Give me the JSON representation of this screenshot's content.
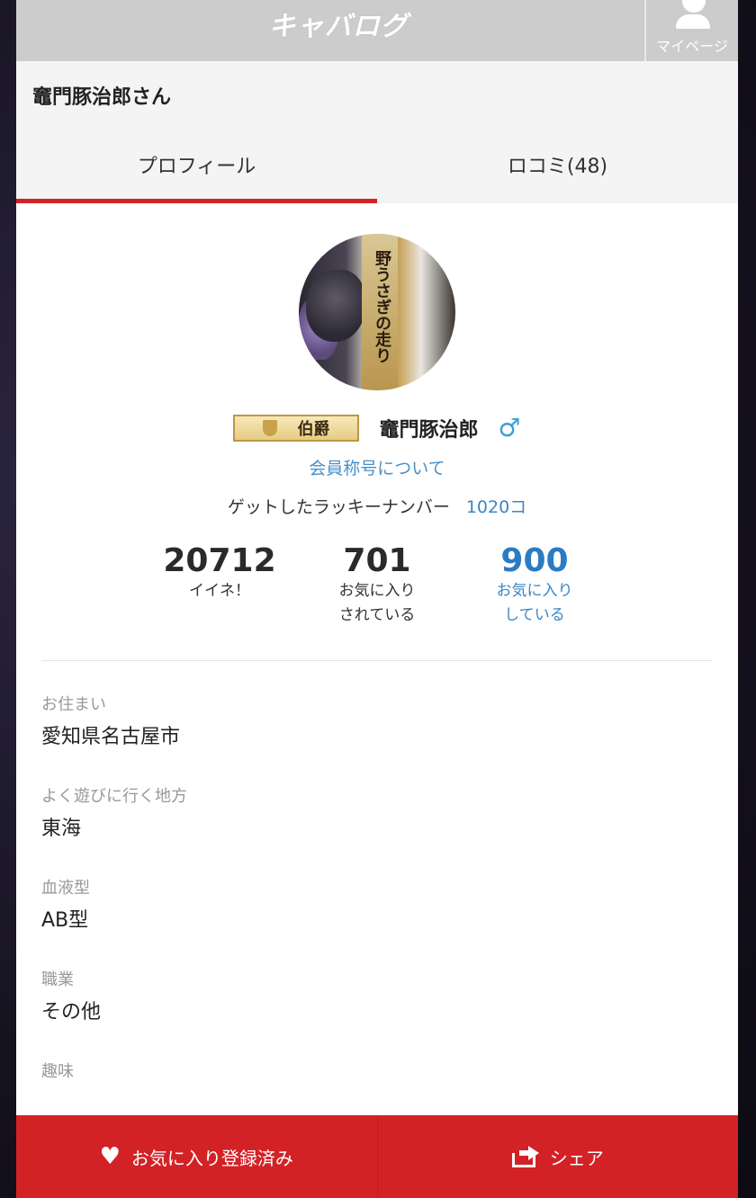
{
  "header": {
    "logo_text": "キャバログ",
    "mypage_label": "マイページ"
  },
  "user": {
    "heading": "竈門豚治郎さん",
    "name": "竈門豚治郎",
    "rank": "伯爵",
    "gender_symbol": "♂"
  },
  "tabs": [
    {
      "label": "プロフィール",
      "active": true
    },
    {
      "label": "ロコミ(48)",
      "active": false
    }
  ],
  "avatar": {
    "label_text": "野うさぎの走り"
  },
  "links": {
    "title_info": "会員称号について"
  },
  "lucky": {
    "label": "ゲットしたラッキーナンバー",
    "count": "1020コ"
  },
  "stats": [
    {
      "value": "20712",
      "caption": "イイネ！"
    },
    {
      "value": "701",
      "caption": "お気に入り\nされている"
    },
    {
      "value": "900",
      "caption": "お気に入り\nしている"
    }
  ],
  "fields": [
    {
      "key": "お住まい",
      "value": "愛知県名古屋市"
    },
    {
      "key": "よく遊びに行く地方",
      "value": "東海"
    },
    {
      "key": "血液型",
      "value": "AB型"
    },
    {
      "key": "職業",
      "value": "その他"
    },
    {
      "key": "趣味",
      "value": ""
    }
  ],
  "actions": {
    "favorite_label": "お気に入り登録済み",
    "share_label": "シェア"
  },
  "colors": {
    "accent": "#d32226",
    "link": "#4a8fc6",
    "header_bg": "#cccccc"
  }
}
